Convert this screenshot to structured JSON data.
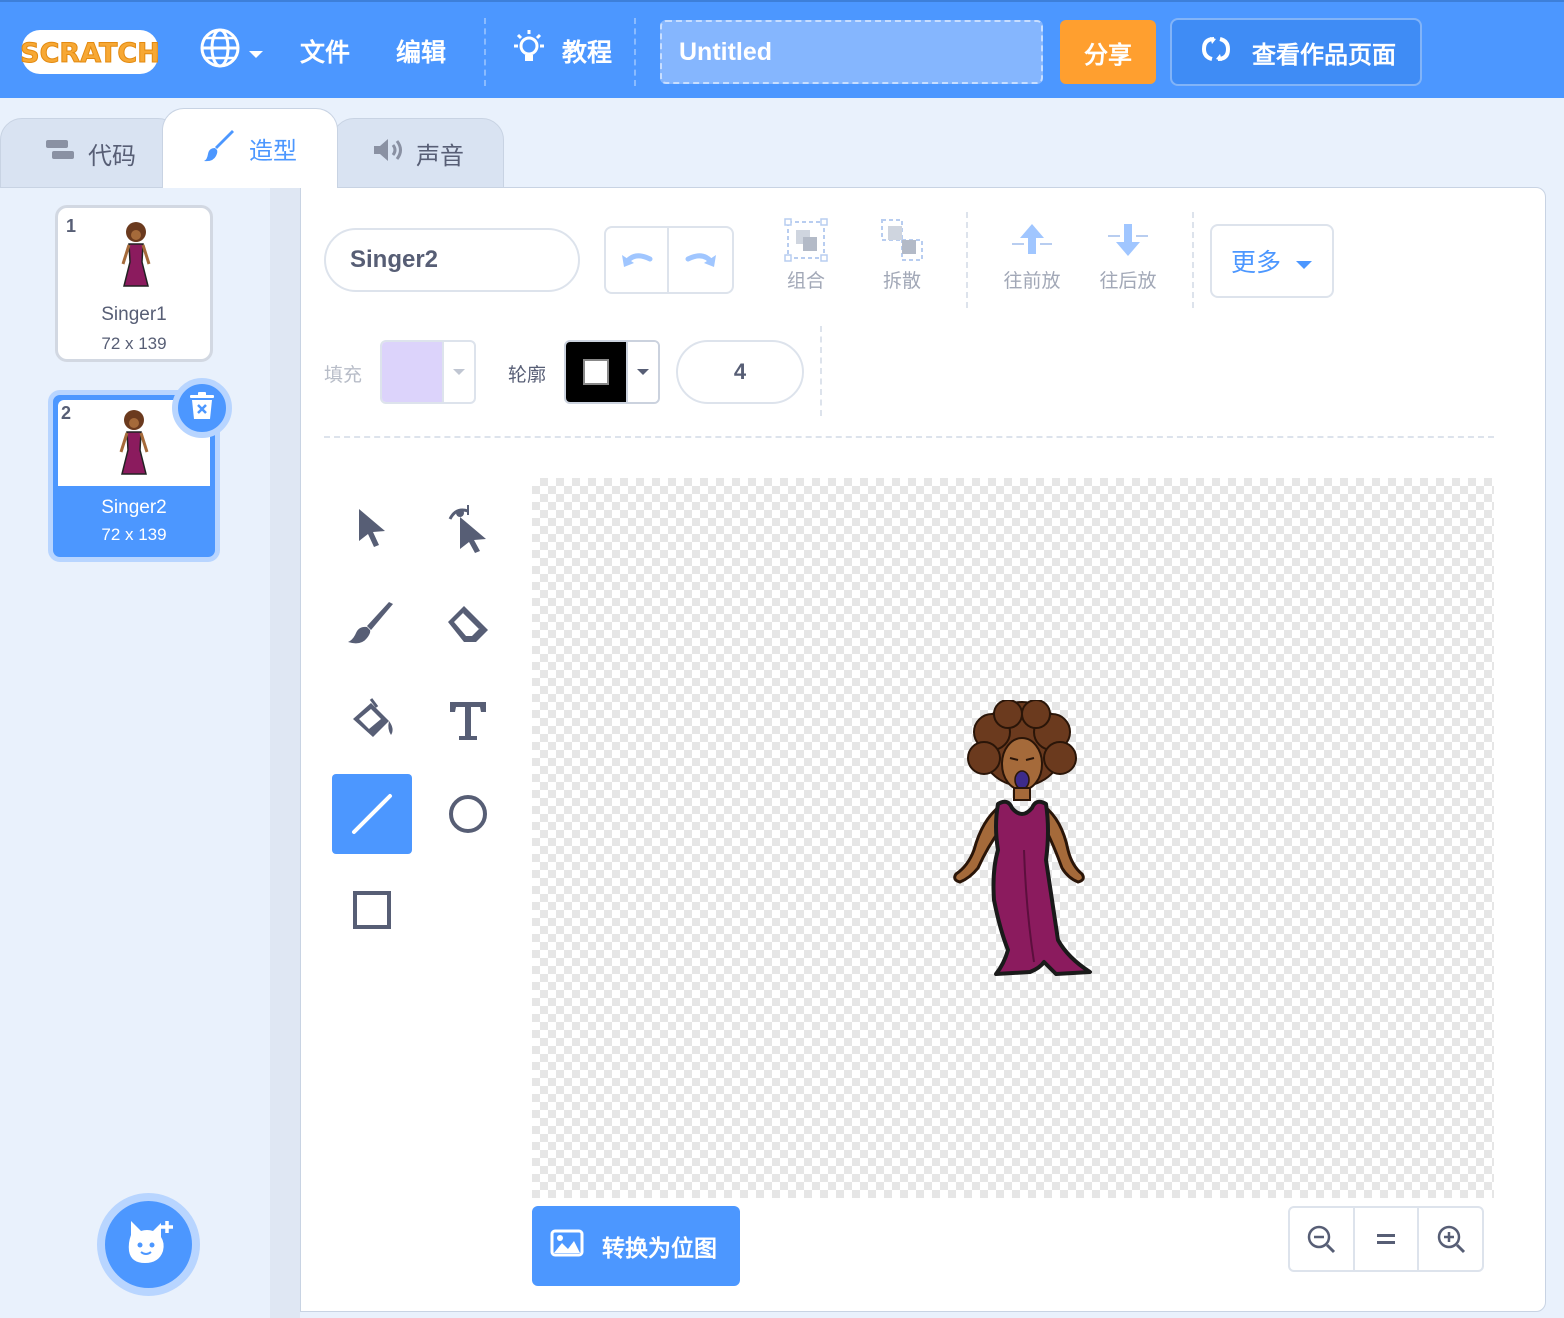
{
  "menubar": {
    "logo_text": "SCRATCH",
    "file": "文件",
    "edit": "编辑",
    "tutorials": "教程",
    "project_title": "Untitled",
    "share": "分享",
    "see_project_page": "查看作品页面"
  },
  "tabs": {
    "code": "代码",
    "costumes": "造型",
    "sounds": "声音"
  },
  "costumes": [
    {
      "number": "1",
      "name": "Singer1",
      "size": "72 x 139"
    },
    {
      "number": "2",
      "name": "Singer2",
      "size": "72 x 139"
    }
  ],
  "editor": {
    "costume_name": "Singer2",
    "group": "组合",
    "ungroup": "拆散",
    "forward": "往前放",
    "backward": "往后放",
    "more": "更多",
    "fill_label": "填充",
    "outline_label": "轮廓",
    "stroke_width": "4",
    "convert_bitmap": "转换为位图"
  },
  "colors": {
    "accent": "#4c97ff",
    "share": "#ff9f2f",
    "fill": "#dcd3fb",
    "outline": "#000000",
    "dress": "#8b1b5e",
    "skin": "#a56a3a",
    "hair": "#6b3a1e"
  },
  "selected_tool": "line",
  "selected_costume": 2
}
